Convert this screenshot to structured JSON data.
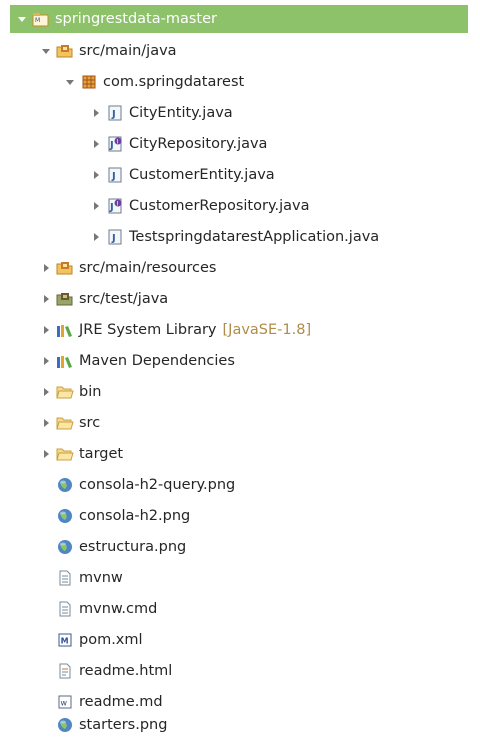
{
  "project": {
    "label": "springrestdata-master"
  },
  "tree": [
    {
      "label": "src/main/java",
      "kind": "package-folder"
    },
    {
      "label": "com.springdatarest",
      "kind": "package"
    },
    {
      "label": "CityEntity.java",
      "kind": "java-class"
    },
    {
      "label": "CityRepository.java",
      "kind": "java-interface"
    },
    {
      "label": "CustomerEntity.java",
      "kind": "java-class"
    },
    {
      "label": "CustomerRepository.java",
      "kind": "java-interface"
    },
    {
      "label": "TestspringdatarestApplication.java",
      "kind": "java-class"
    },
    {
      "label": "src/main/resources",
      "kind": "package-folder"
    },
    {
      "label": "src/test/java",
      "kind": "test-folder"
    },
    {
      "label": "JRE System Library",
      "decoration": "[JavaSE-1.8]",
      "kind": "library"
    },
    {
      "label": "Maven Dependencies",
      "kind": "library"
    },
    {
      "label": "bin",
      "kind": "folder"
    },
    {
      "label": "src",
      "kind": "folder"
    },
    {
      "label": "target",
      "kind": "folder"
    },
    {
      "label": "consola-h2-query.png",
      "kind": "image-file"
    },
    {
      "label": "consola-h2.png",
      "kind": "image-file"
    },
    {
      "label": "estructura.png",
      "kind": "image-file"
    },
    {
      "label": "mvnw",
      "kind": "text-file"
    },
    {
      "label": "mvnw.cmd",
      "kind": "text-file"
    },
    {
      "label": "pom.xml",
      "kind": "maven-file"
    },
    {
      "label": "readme.html",
      "kind": "html-file"
    },
    {
      "label": "readme.md",
      "kind": "markdown-file"
    },
    {
      "label": "starters.png",
      "kind": "image-file"
    }
  ],
  "colors": {
    "selection": "#8dc16a",
    "decoration": "#b08c4a",
    "folder": "#f3c45c"
  }
}
